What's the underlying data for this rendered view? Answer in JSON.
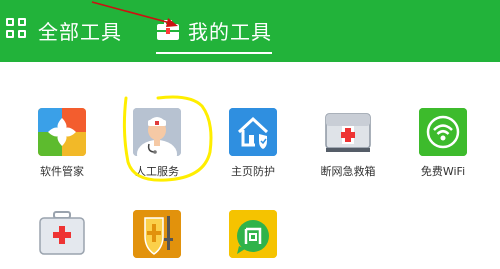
{
  "tabs": {
    "all_tools": "全部工具",
    "my_tools": "我的工具"
  },
  "tools": [
    {
      "label": "软件管家",
      "icon": "software-manager-icon"
    },
    {
      "label": "人工服务",
      "icon": "human-service-icon"
    },
    {
      "label": "主页防护",
      "icon": "homepage-protection-icon"
    },
    {
      "label": "断网急救箱",
      "icon": "network-first-aid-icon"
    },
    {
      "label": "免费WiFi",
      "icon": "free-wifi-icon"
    },
    {
      "label": "",
      "icon": "first-aid-kit-icon"
    },
    {
      "label": "",
      "icon": "shield-sword-icon"
    },
    {
      "label": "",
      "icon": "question-chat-icon"
    }
  ],
  "colors": {
    "header_green": "#22b33a",
    "annotation_yellow": "#ffee00",
    "annotation_red": "#cc1111"
  }
}
